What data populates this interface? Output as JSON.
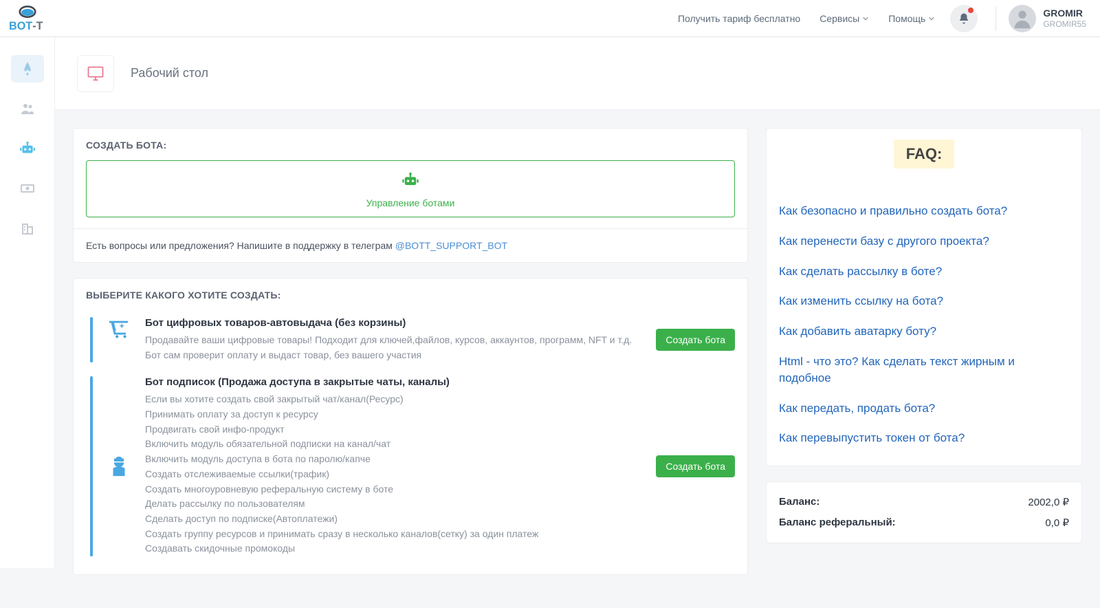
{
  "brand": {
    "name": "BOT-T"
  },
  "header": {
    "tariff": "Получить тариф бесплатно",
    "services": "Сервисы",
    "help": "Помощь"
  },
  "user": {
    "name": "GROMIR",
    "sub": "GROMIR55"
  },
  "page": {
    "title": "Рабочий стол"
  },
  "createBot": {
    "title": "СОЗДАТЬ БОТА:",
    "manage": "Управление ботами",
    "supportPrefix": "Есть вопросы или предложения? Напишите в поддержку в телеграм ",
    "supportLink": "@BOTT_SUPPORT_BOT"
  },
  "choose": {
    "title": "ВЫБЕРИТЕ КАКОГО ХОТИТЕ СОЗДАТЬ:",
    "createLabel": "Создать бота",
    "type1": {
      "title": "Бот цифровых товаров-автовыдача (без корзины)",
      "desc": "Продавайте ваши цифровые товары! Подходит для ключей,файлов, курсов, аккаунтов, программ, NFT и т.д. Бот сам проверит оплату и выдаст товар, без вашего участия"
    },
    "type2": {
      "title": "Бот подписок (Продажа доступа в закрытые чаты, каналы)",
      "lines": [
        "Если вы хотите создать свой закрытый чат/канал(Ресурс)",
        "Принимать оплату за доступ к ресурсу",
        "Продвигать свой инфо-продукт",
        "Включить модуль обязательной подписки на канал/чат",
        "Включить модуль доступа в бота по паролю/капче",
        "Создать отслеживаемые ссылки(трафик)",
        "Создать многоуровневую реферальную систему в боте",
        "Делать рассылку по пользователям",
        "Сделать доступ по подписке(Автоплатежи)",
        "Создать группу ресурсов и принимать сразу в несколько каналов(сетку) за один платеж",
        "Создавать скидочные промокоды"
      ]
    }
  },
  "faq": {
    "title": "FAQ:",
    "items": [
      "Как безопасно и правильно создать бота?",
      "Как перенести базу с другого проекта?",
      "Как сделать рассылку в боте?",
      "Как изменить ссылку на бота?",
      "Как добавить аватарку боту?",
      "Html - что это? Как сделать текст жирным и подобное",
      "Как передать, продать бота?",
      "Как перевыпустить токен от бота?"
    ]
  },
  "balance": {
    "label1": "Баланс:",
    "val1": "2002,0 ₽",
    "label2": "Баланс реферальный:",
    "val2": "0,0 ₽"
  }
}
